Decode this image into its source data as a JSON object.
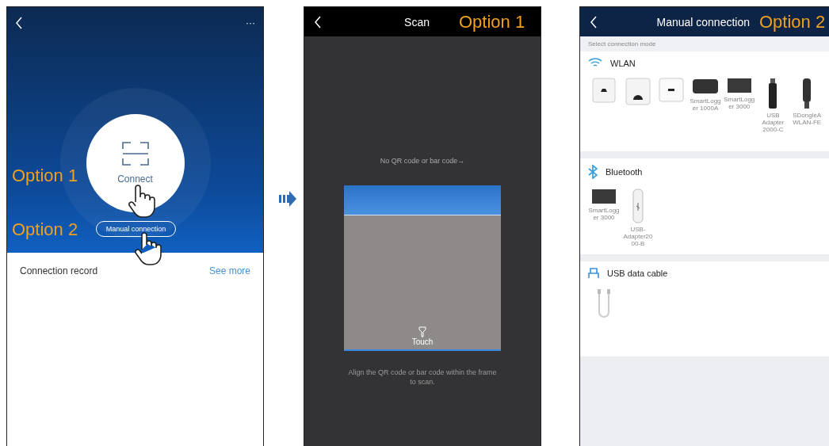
{
  "screens": [
    {
      "kind": "home",
      "more": "···",
      "connect": {
        "label": "Connect"
      },
      "manual_button": "Manual connection",
      "record": {
        "title": "Connection record",
        "link": "See more"
      },
      "annotations": [
        "Option 1",
        "Option 2"
      ]
    },
    {
      "kind": "scan",
      "title": "Scan",
      "annotation": "Option 1",
      "hint": "No QR code or bar code→",
      "touch": "Touch",
      "instructions": "Align the QR code or bar code within the frame to scan."
    },
    {
      "kind": "manual",
      "title": "Manual connection",
      "annotation": "Option 2",
      "subtitle": "Select connection mode",
      "sections": [
        {
          "kind": "wlan",
          "title": "WLAN",
          "devices": [
            {
              "kind": "inverter"
            },
            {
              "kind": "inverter-tall"
            },
            {
              "kind": "inverter-wide"
            },
            {
              "kind": "logger",
              "label": "SmartLogger 1000A"
            },
            {
              "kind": "box",
              "label": "SmartLogger 3000"
            },
            {
              "kind": "stick",
              "label": "USB Adapter 2000-C"
            },
            {
              "kind": "dongle",
              "label": "SDongleA WLAN-FE"
            }
          ]
        },
        {
          "kind": "bluetooth",
          "title": "Bluetooth",
          "devices": [
            {
              "kind": "box",
              "label": "SmartLogger 3000"
            },
            {
              "kind": "adapter",
              "label": "USB-Adapter2000-B"
            }
          ]
        },
        {
          "kind": "usb",
          "title": "USB data cable",
          "devices": [
            {
              "kind": "cable"
            }
          ]
        }
      ]
    }
  ]
}
